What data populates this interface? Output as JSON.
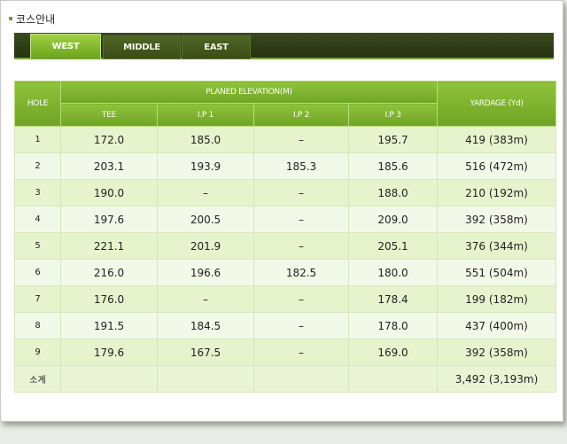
{
  "page": {
    "title": "코스안내"
  },
  "tabs": [
    {
      "label": "WEST",
      "active": true
    },
    {
      "label": "MIDDLE",
      "active": false
    },
    {
      "label": "EAST",
      "active": false
    }
  ],
  "table": {
    "headers": {
      "hole": "HOLE",
      "elevation_group": "PLANED ELEVATION(M)",
      "yardage": "YARDAGE (Yd)",
      "sub": [
        "TEE",
        "I.P 1",
        "I.P 2",
        "I.P 3"
      ]
    },
    "rows": [
      {
        "hole": "1",
        "tee": "172.0",
        "ip1": "185.0",
        "ip2": "–",
        "ip3": "195.7",
        "yardage": "419 (383m)"
      },
      {
        "hole": "2",
        "tee": "203.1",
        "ip1": "193.9",
        "ip2": "185.3",
        "ip3": "185.6",
        "yardage": "516 (472m)"
      },
      {
        "hole": "3",
        "tee": "190.0",
        "ip1": "–",
        "ip2": "–",
        "ip3": "188.0",
        "yardage": "210 (192m)"
      },
      {
        "hole": "4",
        "tee": "197.6",
        "ip1": "200.5",
        "ip2": "–",
        "ip3": "209.0",
        "yardage": "392 (358m)"
      },
      {
        "hole": "5",
        "tee": "221.1",
        "ip1": "201.9",
        "ip2": "–",
        "ip3": "205.1",
        "yardage": "376 (344m)"
      },
      {
        "hole": "6",
        "tee": "216.0",
        "ip1": "196.6",
        "ip2": "182.5",
        "ip3": "180.0",
        "yardage": "551 (504m)"
      },
      {
        "hole": "7",
        "tee": "176.0",
        "ip1": "–",
        "ip2": "–",
        "ip3": "178.4",
        "yardage": "199 (182m)"
      },
      {
        "hole": "8",
        "tee": "191.5",
        "ip1": "184.5",
        "ip2": "–",
        "ip3": "178.0",
        "yardage": "437 (400m)"
      },
      {
        "hole": "9",
        "tee": "179.6",
        "ip1": "167.5",
        "ip2": "–",
        "ip3": "169.0",
        "yardage": "392 (358m)"
      }
    ],
    "total": {
      "label": "소계",
      "yardage": "3,492 (3,193m)"
    }
  },
  "colors": {
    "accent": "#7ab32e",
    "tabbar": "#2f3d16"
  }
}
